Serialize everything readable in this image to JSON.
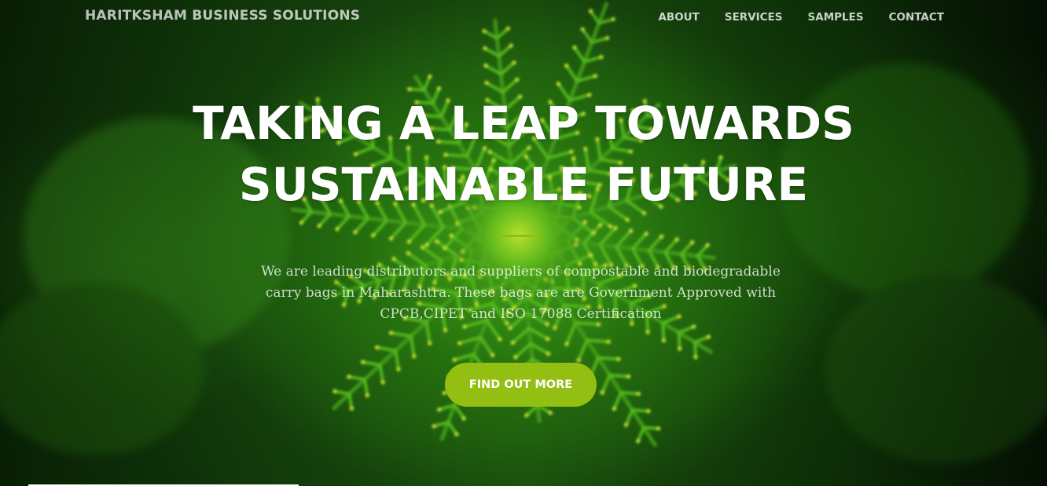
{
  "brand": {
    "name": "HARITKSHAM BUSINESS SOLUTIONS"
  },
  "nav": {
    "items": [
      {
        "label": "ABOUT"
      },
      {
        "label": "SERVICES"
      },
      {
        "label": "SAMPLES"
      },
      {
        "label": "CONTACT"
      }
    ]
  },
  "hero": {
    "headline_line1": "TAKING A LEAP TOWARDS",
    "headline_line2": "SUSTAINABLE FUTURE",
    "description": "We are leading distributors and suppliers of compostable and biodegradable carry bags in Maharashtra. These bags are are Government Approved with CPCB,CIPET and ISO 17088 Certification",
    "cta_label": "FIND OUT MORE",
    "accent_color": "#93be12",
    "background_image": "green-fern-plant-background"
  }
}
